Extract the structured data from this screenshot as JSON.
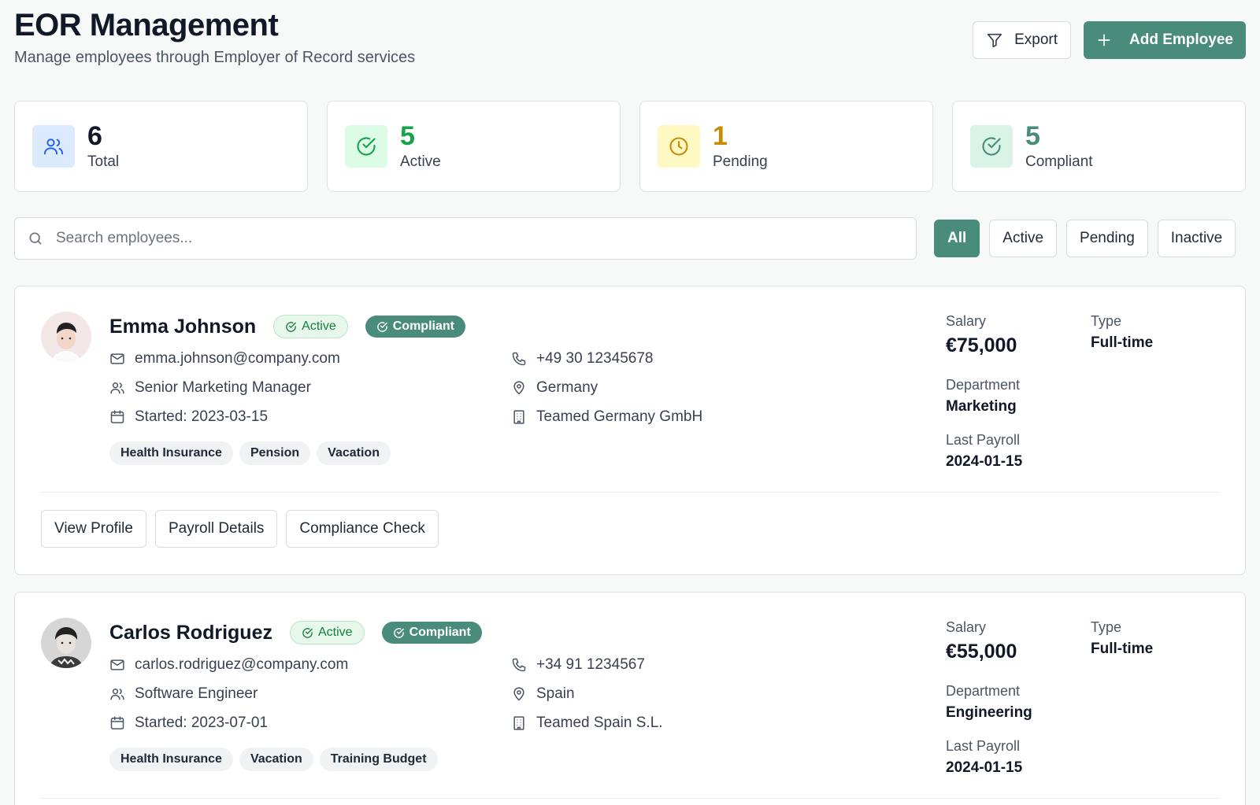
{
  "header": {
    "title": "EOR Management",
    "subtitle": "Manage employees through Employer of Record services",
    "export_label": "Export",
    "add_label": "Add Employee"
  },
  "stats": [
    {
      "value": "6",
      "label": "Total",
      "color": "#111827",
      "icon": "users-icon",
      "bg": "#dbeafe"
    },
    {
      "value": "5",
      "label": "Active",
      "color": "#16a34a",
      "icon": "check-circle-icon",
      "bg": "#dcfce7"
    },
    {
      "value": "1",
      "label": "Pending",
      "color": "#ca8a04",
      "icon": "clock-icon",
      "bg": "#fef9c3"
    },
    {
      "value": "5",
      "label": "Compliant",
      "color": "#4a8c7b",
      "icon": "check-circle-icon",
      "bg": "#d9f3e7"
    }
  ],
  "search": {
    "placeholder": "Search employees..."
  },
  "filters": [
    "All",
    "Active",
    "Pending",
    "Inactive"
  ],
  "status_labels": {
    "active": "Active",
    "compliant": "Compliant"
  },
  "side_labels": {
    "salary": "Salary",
    "type": "Type",
    "department": "Department",
    "last_payroll": "Last Payroll"
  },
  "actions": [
    "View Profile",
    "Payroll Details",
    "Compliance Check"
  ],
  "employees": [
    {
      "name": "Emma Johnson",
      "email": "emma.johnson@company.com",
      "role": "Senior Marketing Manager",
      "started": "Started: 2023-03-15",
      "phone": "+49 30 12345678",
      "country": "Germany",
      "entity": "Teamed Germany GmbH",
      "benefits": [
        "Health Insurance",
        "Pension",
        "Vacation"
      ],
      "salary": "€75,000",
      "type": "Full-time",
      "department": "Marketing",
      "last_payroll": "2024-01-15"
    },
    {
      "name": "Carlos Rodriguez",
      "email": "carlos.rodriguez@company.com",
      "role": "Software Engineer",
      "started": "Started: 2023-07-01",
      "phone": "+34 91 1234567",
      "country": "Spain",
      "entity": "Teamed Spain S.L.",
      "benefits": [
        "Health Insurance",
        "Vacation",
        "Training Budget"
      ],
      "salary": "€55,000",
      "type": "Full-time",
      "department": "Engineering",
      "last_payroll": "2024-01-15"
    }
  ]
}
